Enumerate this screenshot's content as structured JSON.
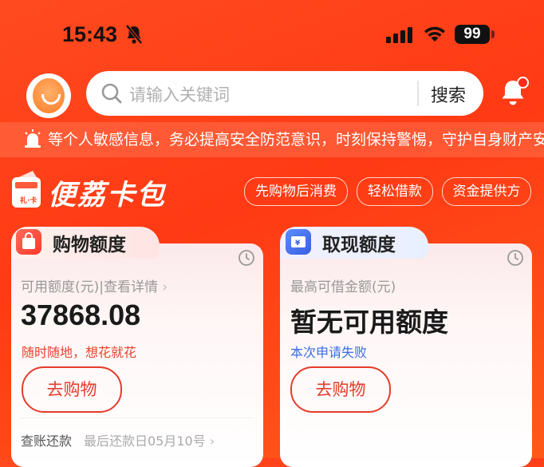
{
  "status_bar": {
    "time": "15:43",
    "battery": "99"
  },
  "header": {
    "search_placeholder": "请输入关键词",
    "search_button": "搜索"
  },
  "notice": {
    "text": "等个人敏感信息，务必提高安全防范意识，时刻保持警惕，守护自身财产安全"
  },
  "brand": {
    "name": "便荔卡包",
    "tags": [
      "先购物后消费",
      "轻松借款",
      "资金提供方"
    ]
  },
  "cards": {
    "shopping": {
      "title": "购物额度",
      "label": "可用额度(元)|查看详情",
      "amount": "37868.08",
      "hint": "随时随地，想花就花",
      "button": "去购物",
      "footer_left": "查账还款",
      "footer_right": "最后还款日05月10号"
    },
    "cash": {
      "title": "取现额度",
      "label": "最高可借金额(元)",
      "amount": "暂无可用额度",
      "hint": "本次申请失败",
      "button": "去购物"
    }
  },
  "colors": {
    "accent": "#e63b2a",
    "background": "#ff4a1f",
    "link_blue": "#3a6ee0"
  }
}
